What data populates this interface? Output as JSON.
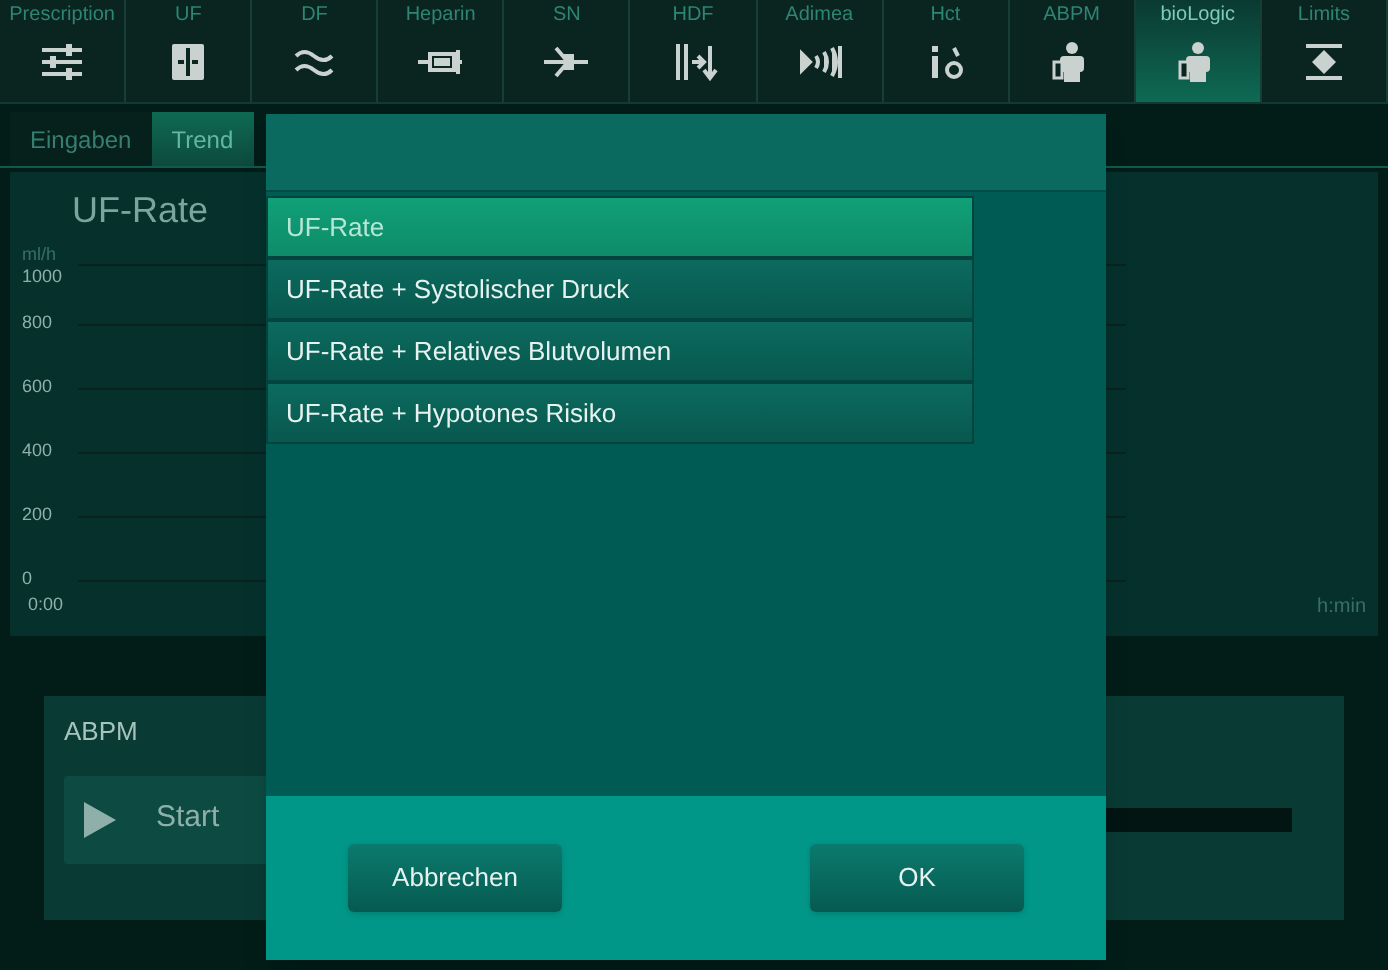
{
  "top_tabs": [
    {
      "label": "Prescription",
      "selected": false
    },
    {
      "label": "UF",
      "selected": false
    },
    {
      "label": "DF",
      "selected": false
    },
    {
      "label": "Heparin",
      "selected": false
    },
    {
      "label": "SN",
      "selected": false
    },
    {
      "label": "HDF",
      "selected": false
    },
    {
      "label": "Adimea",
      "selected": false
    },
    {
      "label": "Hct",
      "selected": false
    },
    {
      "label": "ABPM",
      "selected": false
    },
    {
      "label": "bioLogic",
      "selected": true
    },
    {
      "label": "Limits",
      "selected": false
    }
  ],
  "sub_tabs": [
    {
      "label": "Eingaben",
      "selected": false
    },
    {
      "label": "Trend",
      "selected": true
    }
  ],
  "trend": {
    "title": "UF-Rate",
    "unit": "ml/h",
    "y_ticks": [
      "1000",
      "800",
      "600",
      "400",
      "200",
      "0"
    ],
    "x_start": "0:00",
    "x_unit": "h:min"
  },
  "abpm": {
    "title": "ABPM",
    "start_button": "Start"
  },
  "dialog": {
    "options": [
      {
        "label": "UF-Rate",
        "selected": true
      },
      {
        "label": "UF-Rate + Systolischer Druck",
        "selected": false
      },
      {
        "label": "UF-Rate + Relatives Blutvolumen",
        "selected": false
      },
      {
        "label": "UF-Rate + Hypotones Risiko",
        "selected": false
      }
    ],
    "cancel_button": "Abbrechen",
    "ok_button": "OK"
  }
}
